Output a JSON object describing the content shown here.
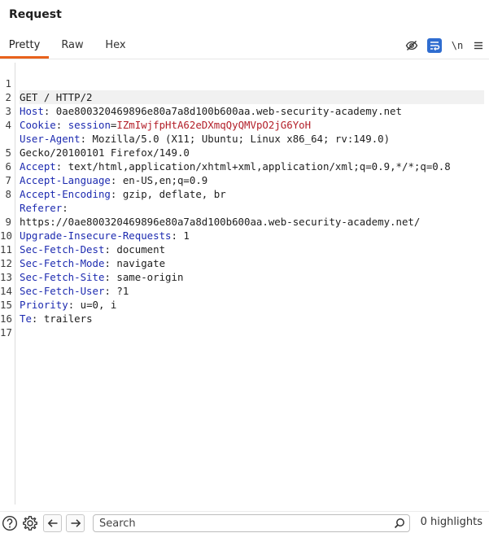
{
  "panel": {
    "title": "Request"
  },
  "tabs": [
    {
      "label": "Pretty",
      "active": true
    },
    {
      "label": "Raw",
      "active": false
    },
    {
      "label": "Hex",
      "active": false
    }
  ],
  "toolbar": {
    "newline_label": "\\n"
  },
  "request": {
    "lines": [
      {
        "n": "1",
        "text": "GET / HTTP/2"
      },
      {
        "n": "2",
        "key": "Host",
        "value": " 0ae800320469896e80a7a8d100b600aa.web-security-academy.net"
      },
      {
        "n": "3",
        "key": "Cookie",
        "cookie_name": "session",
        "cookie_value": "IZmIwjfpHtA62eDXmqQyQMVpO2jG6YoH"
      },
      {
        "n": "4",
        "key": "User-Agent",
        "value": " Mozilla/5.0 (X11; Ubuntu; Linux x86_64; rv:149.0)"
      },
      {
        "n": "",
        "text": "Gecko/20100101 Firefox/149.0"
      },
      {
        "n": "5",
        "key": "Accept",
        "value": " text/html,application/xhtml+xml,application/xml;q=0.9,*/*;q=0.8"
      },
      {
        "n": "6",
        "key": "Accept-Language",
        "value": " en-US,en;q=0.9"
      },
      {
        "n": "7",
        "key": "Accept-Encoding",
        "value": " gzip, deflate, br"
      },
      {
        "n": "8",
        "key": "Referer",
        "value": ""
      },
      {
        "n": "",
        "text": "https://0ae800320469896e80a7a8d100b600aa.web-security-academy.net/"
      },
      {
        "n": "9",
        "key": "Upgrade-Insecure-Requests",
        "value": " 1"
      },
      {
        "n": "10",
        "key": "Sec-Fetch-Dest",
        "value": " document"
      },
      {
        "n": "11",
        "key": "Sec-Fetch-Mode",
        "value": " navigate"
      },
      {
        "n": "12",
        "key": "Sec-Fetch-Site",
        "value": " same-origin"
      },
      {
        "n": "13",
        "key": "Sec-Fetch-User",
        "value": " ?1"
      },
      {
        "n": "14",
        "key": "Priority",
        "value": " u=0, i"
      },
      {
        "n": "15",
        "key": "Te",
        "value": " trailers"
      },
      {
        "n": "16",
        "text": ""
      },
      {
        "n": "17",
        "text": ""
      }
    ]
  },
  "footer": {
    "search_placeholder": "Search",
    "highlights": "0 highlights"
  },
  "colors": {
    "accent": "#e8621c",
    "header_key": "#1d2bb0",
    "cookie_value": "#b3202a",
    "wrap_button": "#2f6dd0"
  }
}
